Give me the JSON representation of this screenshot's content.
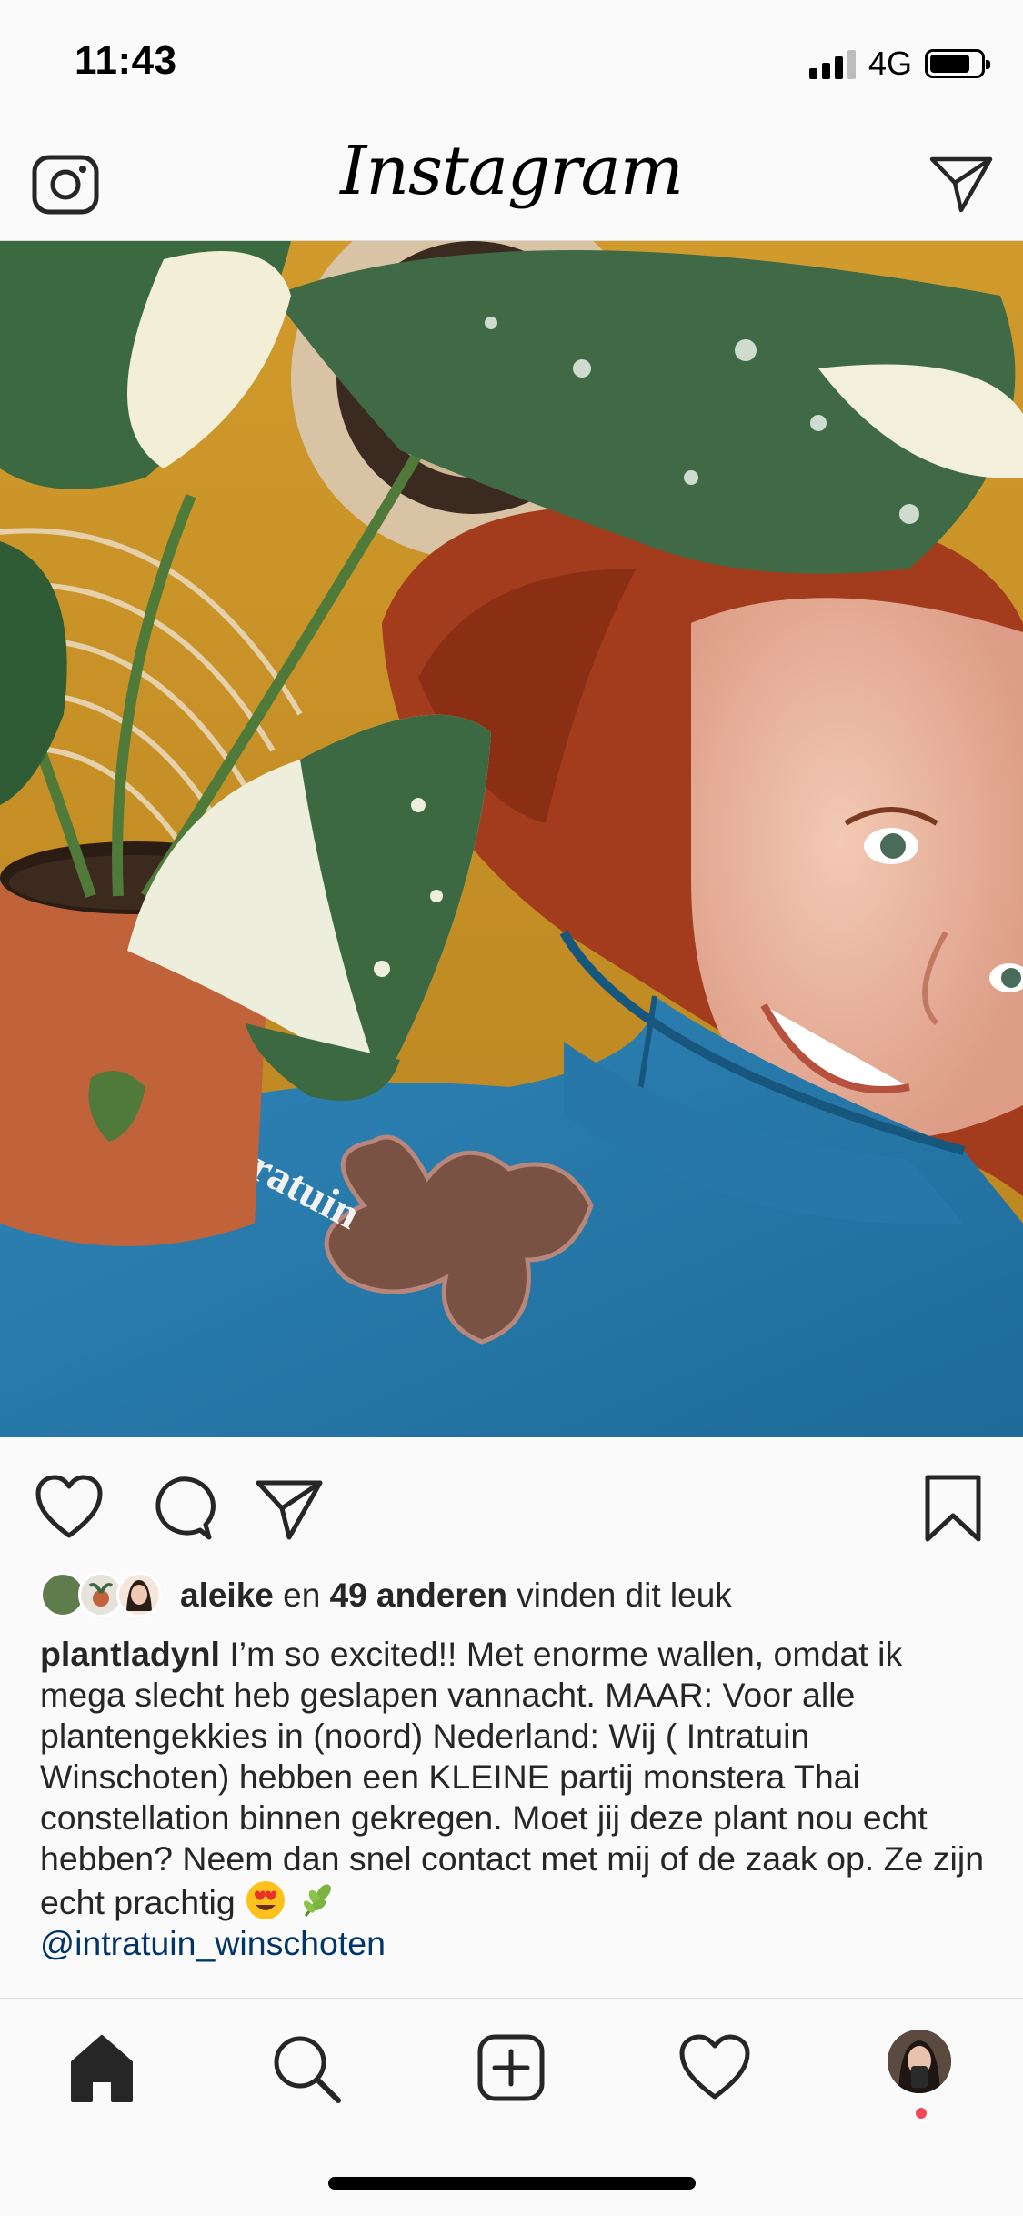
{
  "status_bar": {
    "time": "11:43",
    "network": "4G",
    "signal_bars": 4,
    "signal_bars_active": 3,
    "battery_level": 0.8
  },
  "top_nav": {
    "logo": "Instagram",
    "left_icon": "camera-icon",
    "right_icon": "direct-message-icon"
  },
  "post": {
    "image_icon_names": [
      "monstera-plant",
      "woman-selfie",
      "blue-sweater",
      "terracotta-pot"
    ],
    "actions": {
      "like_icon": "heart-icon",
      "comment_icon": "comment-icon",
      "share_icon": "share-icon",
      "save_icon": "bookmark-icon"
    },
    "likes": {
      "first_user": "aleike",
      "connector": " en ",
      "others": "49 anderen",
      "suffix": " vinden dit leuk"
    },
    "caption": {
      "username": "plantladynl",
      "text": " I’m so excited!! Met enorme wallen, omdat ik mega slecht heb geslapen vannacht. MAAR: Voor alle plantengekkies in (noord) Nederland: Wij ( Intratuin Winschoten) hebben een KLEINE partij monstera Thai constellation binnen gekregen. Moet jij deze plant nou echt hebben? Neem dan snel contact met mij of de zaak op. Ze zijn echt prachtig ",
      "emojis": [
        "heart-eyes-emoji",
        "herb-emoji"
      ],
      "mention": "@intratuin_winschoten"
    },
    "sweater_text": "intratuin"
  },
  "tab_bar": {
    "items": [
      "home-icon",
      "search-icon",
      "new-post-icon",
      "activity-heart-icon",
      "profile-avatar"
    ],
    "active": "home-icon"
  },
  "colors": {
    "background": "#fafafa",
    "text": "#262626",
    "link": "#003569",
    "notification": "#ed4956"
  }
}
